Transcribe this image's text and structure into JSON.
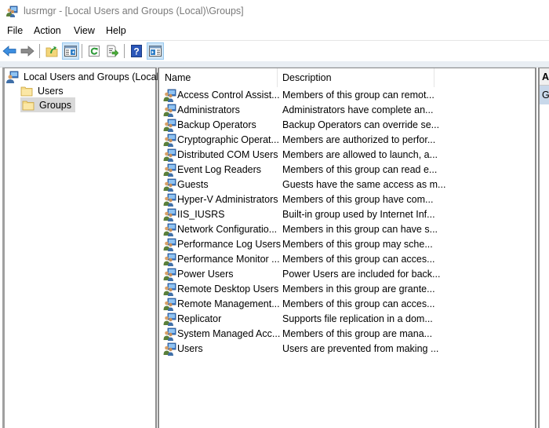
{
  "window": {
    "title": "lusrmgr - [Local Users and Groups (Local)\\Groups]",
    "app_icon": "users-groups-icon"
  },
  "menubar": {
    "items": [
      {
        "label": "File"
      },
      {
        "label": "Action"
      },
      {
        "label": "View"
      },
      {
        "label": "Help"
      }
    ]
  },
  "toolbar": {
    "buttons": [
      {
        "name": "back",
        "icon": "back-arrow-icon",
        "active": false
      },
      {
        "name": "forward",
        "icon": "forward-arrow-icon",
        "active": false
      },
      {
        "name": "up-one-level",
        "icon": "up-folder-icon",
        "active": false
      },
      {
        "name": "show-hide-console-tree",
        "icon": "console-tree-icon",
        "active": true
      },
      {
        "name": "refresh",
        "icon": "refresh-icon",
        "active": false
      },
      {
        "name": "export-list",
        "icon": "export-list-icon",
        "active": false
      },
      {
        "name": "help",
        "icon": "help-icon",
        "active": false
      },
      {
        "name": "show-hide-action-pane",
        "icon": "action-pane-icon",
        "active": true
      }
    ]
  },
  "tree": {
    "root": {
      "label": "Local Users and Groups (Local)",
      "icon": "computer-users-icon"
    },
    "children": [
      {
        "label": "Users",
        "icon": "folder-icon",
        "selected": false
      },
      {
        "label": "Groups",
        "icon": "folder-icon",
        "selected": true
      }
    ]
  },
  "list": {
    "columns": [
      {
        "label": "Name"
      },
      {
        "label": "Description"
      }
    ],
    "rows": [
      {
        "name": "Access Control Assist...",
        "description": "Members of this group can remot..."
      },
      {
        "name": "Administrators",
        "description": "Administrators have complete an..."
      },
      {
        "name": "Backup Operators",
        "description": "Backup Operators can override se..."
      },
      {
        "name": "Cryptographic Operat...",
        "description": "Members are authorized to perfor..."
      },
      {
        "name": "Distributed COM Users",
        "description": "Members are allowed to launch, a..."
      },
      {
        "name": "Event Log Readers",
        "description": "Members of this group can read e..."
      },
      {
        "name": "Guests",
        "description": "Guests have the same access as m..."
      },
      {
        "name": "Hyper-V Administrators",
        "description": "Members of this group have com..."
      },
      {
        "name": "IIS_IUSRS",
        "description": "Built-in group used by Internet Inf..."
      },
      {
        "name": "Network Configuratio...",
        "description": "Members in this group can have s..."
      },
      {
        "name": "Performance Log Users",
        "description": "Members of this group may sche..."
      },
      {
        "name": "Performance Monitor ...",
        "description": "Members of this group can acces..."
      },
      {
        "name": "Power Users",
        "description": "Power Users are included for back..."
      },
      {
        "name": "Remote Desktop Users",
        "description": "Members in this group are grante..."
      },
      {
        "name": "Remote Management...",
        "description": "Members of this group can acces..."
      },
      {
        "name": "Replicator",
        "description": "Supports file replication in a dom..."
      },
      {
        "name": "System Managed Acc...",
        "description": "Members of this group are mana..."
      },
      {
        "name": "Users",
        "description": "Users are prevented from making ..."
      }
    ]
  },
  "actions_pane": {
    "header": "A",
    "selected_item": "G"
  }
}
